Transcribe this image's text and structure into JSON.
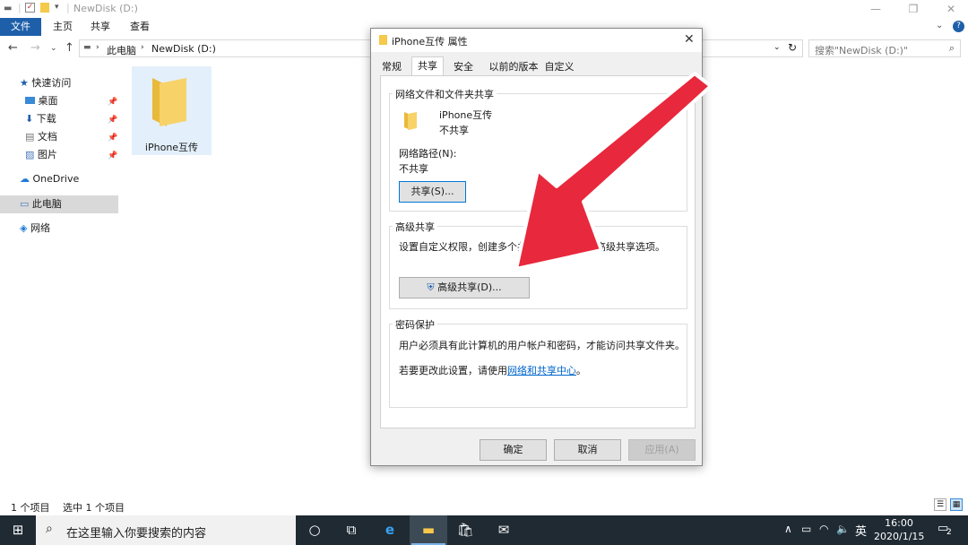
{
  "explorer": {
    "title": "NewDisk (D:)",
    "ribbon_tabs": [
      "文件",
      "主页",
      "共享",
      "查看"
    ],
    "breadcrumb": [
      "此电脑",
      "NewDisk (D:)"
    ],
    "search_placeholder": "搜索\"NewDisk (D:)\"",
    "nav": {
      "quick_access": "快速访问",
      "desktop": "桌面",
      "downloads": "下载",
      "documents": "文档",
      "pictures": "图片",
      "onedrive": "OneDrive",
      "this_pc": "此电脑",
      "network": "网络"
    },
    "folder_name": "iPhone互传",
    "status_count": "1 个项目",
    "status_selected": "选中 1 个项目"
  },
  "dialog": {
    "title": "iPhone互传 属性",
    "tabs": [
      "常规",
      "共享",
      "安全",
      "以前的版本",
      "自定义"
    ],
    "active_tab": "共享",
    "network_sharing": {
      "group_label": "网络文件和文件夹共享",
      "folder_name": "iPhone互传",
      "folder_status": "不共享",
      "path_label": "网络路径(N):",
      "path_value": "不共享",
      "share_button": "共享(S)..."
    },
    "advanced_sharing": {
      "group_label": "高级共享",
      "desc": "设置自定义权限，创建多个共享，并设置其他高级共享选项。",
      "button": "高级共享(D)..."
    },
    "password": {
      "group_label": "密码保护",
      "desc": "用户必须具有此计算机的用户帐户和密码，才能访问共享文件夹。",
      "change_prefix": "若要更改此设置，请使用",
      "change_link": "网络和共享中心",
      "change_suffix": "。"
    },
    "buttons": {
      "ok": "确定",
      "cancel": "取消",
      "apply": "应用(A)"
    }
  },
  "taskbar": {
    "search_placeholder": "在这里输入你要搜索的内容",
    "time": "16:00",
    "date": "2020/1/15",
    "ime": "英",
    "notifications": "2"
  },
  "colors": {
    "accent": "#1e5faa",
    "arrow": "#e8283c",
    "taskbar": "#1f2a33",
    "folder": "#f5c94a"
  }
}
